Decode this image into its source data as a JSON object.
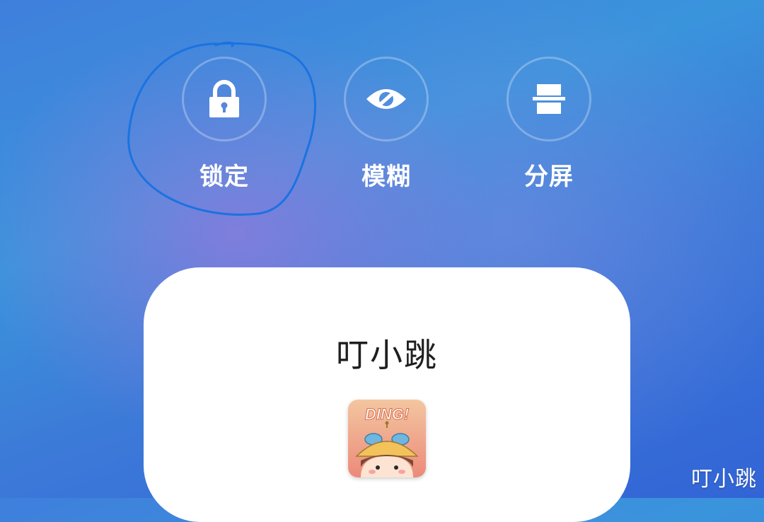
{
  "actions": [
    {
      "label": "锁定",
      "icon": "lock-icon"
    },
    {
      "label": "模糊",
      "icon": "eye-blur-icon"
    },
    {
      "label": "分屏",
      "icon": "split-screen-icon"
    }
  ],
  "card": {
    "app_name": "叮小跳",
    "app_icon": "ding-app-icon",
    "app_icon_text": "DING!"
  },
  "watermark": "叮小跳",
  "colors": {
    "annotation": "#1a73e0",
    "card_bg": "#ffffff",
    "icon_fill": "#ffffff"
  }
}
